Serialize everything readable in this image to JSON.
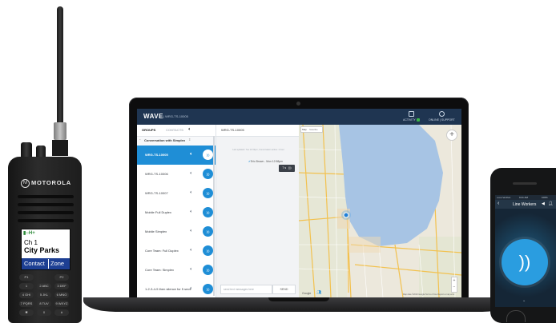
{
  "wave_app": {
    "brand": "WAVE",
    "header_sub": "| WRG-TS-10005",
    "topbar": {
      "activity_label": "ACTIVITY",
      "online_label": "ONLINE | SUPPORT"
    },
    "tabs": {
      "groups": "GROUPS",
      "contacts": "CONTACTS"
    },
    "conversation_header": "Conversation with Simplex",
    "groups": [
      {
        "name": "WRG-TS-10005",
        "active": true
      },
      {
        "name": "WRG-TS-10006",
        "active": false
      },
      {
        "name": "WRG-TS-10007",
        "active": false
      },
      {
        "name": "Mobile Full Duplex",
        "active": false
      },
      {
        "name": "Mobile Simplex",
        "active": false
      },
      {
        "name": "Core Team: Full Duplex",
        "active": false
      },
      {
        "name": "Core Team: Simplex",
        "active": false
      },
      {
        "name": "1-2-3-4-5 then silence for 5 secs",
        "active": false
      }
    ],
    "chat": {
      "title": "WRG-TS-10005",
      "system_note": "Last updated: Tue 12:33pm, Conversation active: 1 hour",
      "message": "Eric Brown - Mon 12:58pm",
      "bubble": "7 s",
      "input_placeholder": "send text messages here",
      "send_label": "SEND"
    },
    "map": {
      "tab_map": "Map",
      "tab_satellite": "Satellite",
      "zoom_label": "+",
      "logo": "Google",
      "credit": "Map data ©2019 Google  Terms of Use  Report a map error"
    }
  },
  "radio": {
    "brand": "MOTOROLA",
    "display_icons": "▮○H+",
    "channel": "Ch 1",
    "name": "City Parks",
    "softkey_left": "Contact",
    "softkey_right": "Zone",
    "keys": [
      "P1",
      "P2",
      "1",
      "2 ABC",
      "3 DEF",
      "4 GHI",
      "5 JKL",
      "6 MNO",
      "7 PQRS",
      "8 TUV",
      "9 WXYZ",
      "✱",
      "0",
      "#"
    ]
  },
  "phone": {
    "status_left": "•••oo Verizon",
    "status_time": "9:41 AM",
    "status_right": "100%",
    "back_icon": "‹",
    "title": "Line Workers",
    "ptt_glyph": "))",
    "chevron": "⌄"
  },
  "colors": {
    "wave_header": "#1f3551",
    "accent_blue": "#1f8ed6",
    "radio_softkey": "#1d3f93",
    "lake": "#a7c4e4"
  }
}
